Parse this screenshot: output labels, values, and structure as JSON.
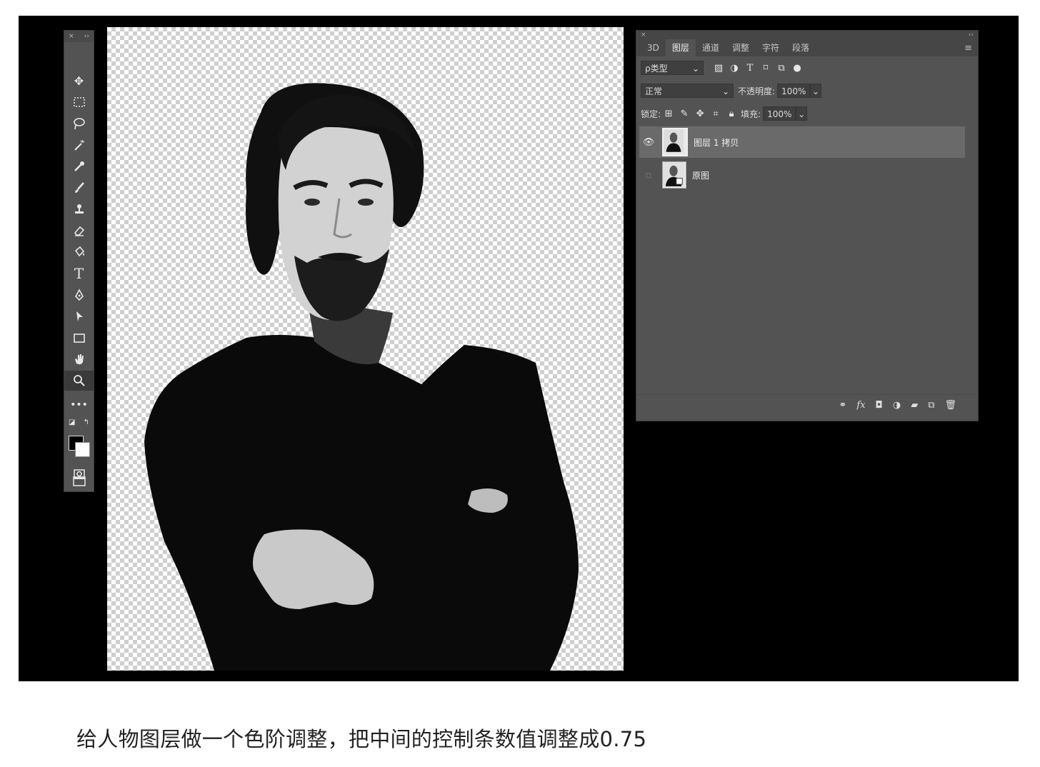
{
  "tools_panel": {
    "close": "×",
    "collapse": "››",
    "tools": [
      "move-icon",
      "marquee-icon",
      "lasso-icon",
      "magic-wand-icon",
      "eyedropper-icon",
      "brush-icon",
      "stamp-icon",
      "eraser-icon",
      "paint-bucket-icon",
      "type-icon",
      "pen-icon",
      "path-select-icon",
      "rectangle-icon",
      "hand-icon",
      "zoom-icon",
      "more-icon"
    ],
    "active_tool": "zoom-icon",
    "foreground_color": "#000000",
    "background_color": "#ffffff"
  },
  "layers_panel": {
    "close": "×",
    "collapse": "‹‹",
    "tabs": [
      "3D",
      "图层",
      "通道",
      "调整",
      "字符",
      "段落"
    ],
    "active_tab": "图层",
    "filter_label": "ρ类型",
    "blend_mode": "正常",
    "opacity_label": "不透明度:",
    "opacity_value": "100%",
    "lock_label": "锁定:",
    "fill_label": "填充:",
    "fill_value": "100%",
    "layers": [
      {
        "name": "图层 1 拷贝",
        "visible": true,
        "selected": true
      },
      {
        "name": "原图",
        "visible": false,
        "selected": false
      }
    ],
    "footer_icons": [
      "link-icon",
      "fx-icon",
      "mask-icon",
      "adjustment-icon",
      "folder-icon",
      "new-layer-icon",
      "trash-icon"
    ]
  },
  "caption": "给人物图层做一个色阶调整，把中间的控制条数值调整成0.75"
}
